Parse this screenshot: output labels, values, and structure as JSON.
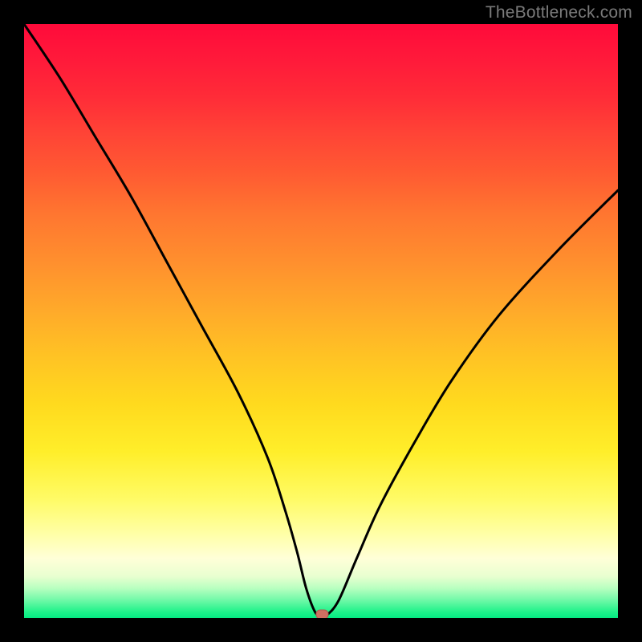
{
  "watermark": "TheBottleneck.com",
  "colors": {
    "curve_stroke": "#000000",
    "marker_fill": "#cf6f62",
    "marker_stroke": "#b25a4e",
    "frame_bg": "#000000"
  },
  "chart_data": {
    "type": "line",
    "title": "",
    "xlabel": "",
    "ylabel": "",
    "xlim": [
      0,
      100
    ],
    "ylim": [
      0,
      100
    ],
    "grid": false,
    "legend": false,
    "x": [
      0,
      6,
      12,
      18,
      24,
      30,
      36,
      41,
      44,
      46,
      47.5,
      49,
      50,
      51,
      53,
      56,
      60,
      66,
      72,
      80,
      90,
      100
    ],
    "values": [
      100,
      91,
      81,
      71,
      60,
      49,
      38,
      27,
      18,
      11,
      5,
      1,
      0.5,
      0.5,
      3,
      10,
      19,
      30,
      40,
      51,
      62,
      72
    ],
    "marker": {
      "x": 50.2,
      "y": 0.6
    },
    "flat_bottom_range": [
      48.7,
      51.0
    ]
  }
}
